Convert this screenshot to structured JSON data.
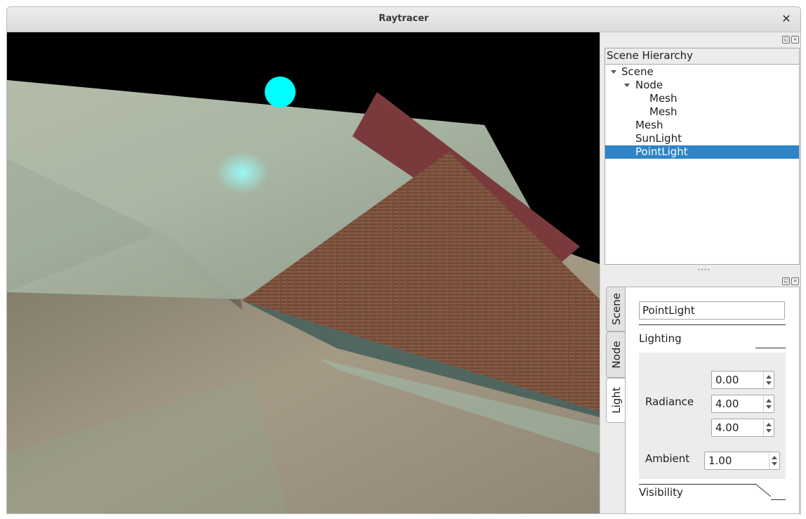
{
  "window": {
    "title": "Raytracer",
    "close_label": "✕"
  },
  "hierarchy": {
    "title": "Scene Hierarchy",
    "items": [
      {
        "label": "Scene",
        "depth": 0,
        "expanded": true
      },
      {
        "label": "Node",
        "depth": 1,
        "expanded": true
      },
      {
        "label": "Mesh",
        "depth": 2
      },
      {
        "label": "Mesh",
        "depth": 2
      },
      {
        "label": "Mesh",
        "depth": 1
      },
      {
        "label": "SunLight",
        "depth": 1
      },
      {
        "label": "PointLight",
        "depth": 1,
        "selected": true
      }
    ]
  },
  "properties": {
    "tabs": [
      "Scene",
      "Node",
      "Light"
    ],
    "active_tab": "Light",
    "name_value": "PointLight",
    "lighting_section": "Lighting",
    "radiance_label": "Radiance",
    "radiance": [
      "0.00",
      "4.00",
      "4.00"
    ],
    "ambient_label": "Ambient",
    "ambient": "1.00",
    "visibility_section": "Visibility"
  },
  "colors": {
    "selection": "#2e84c6",
    "point_light": "#00ffff",
    "brick_panel": "#7a3a3c"
  }
}
